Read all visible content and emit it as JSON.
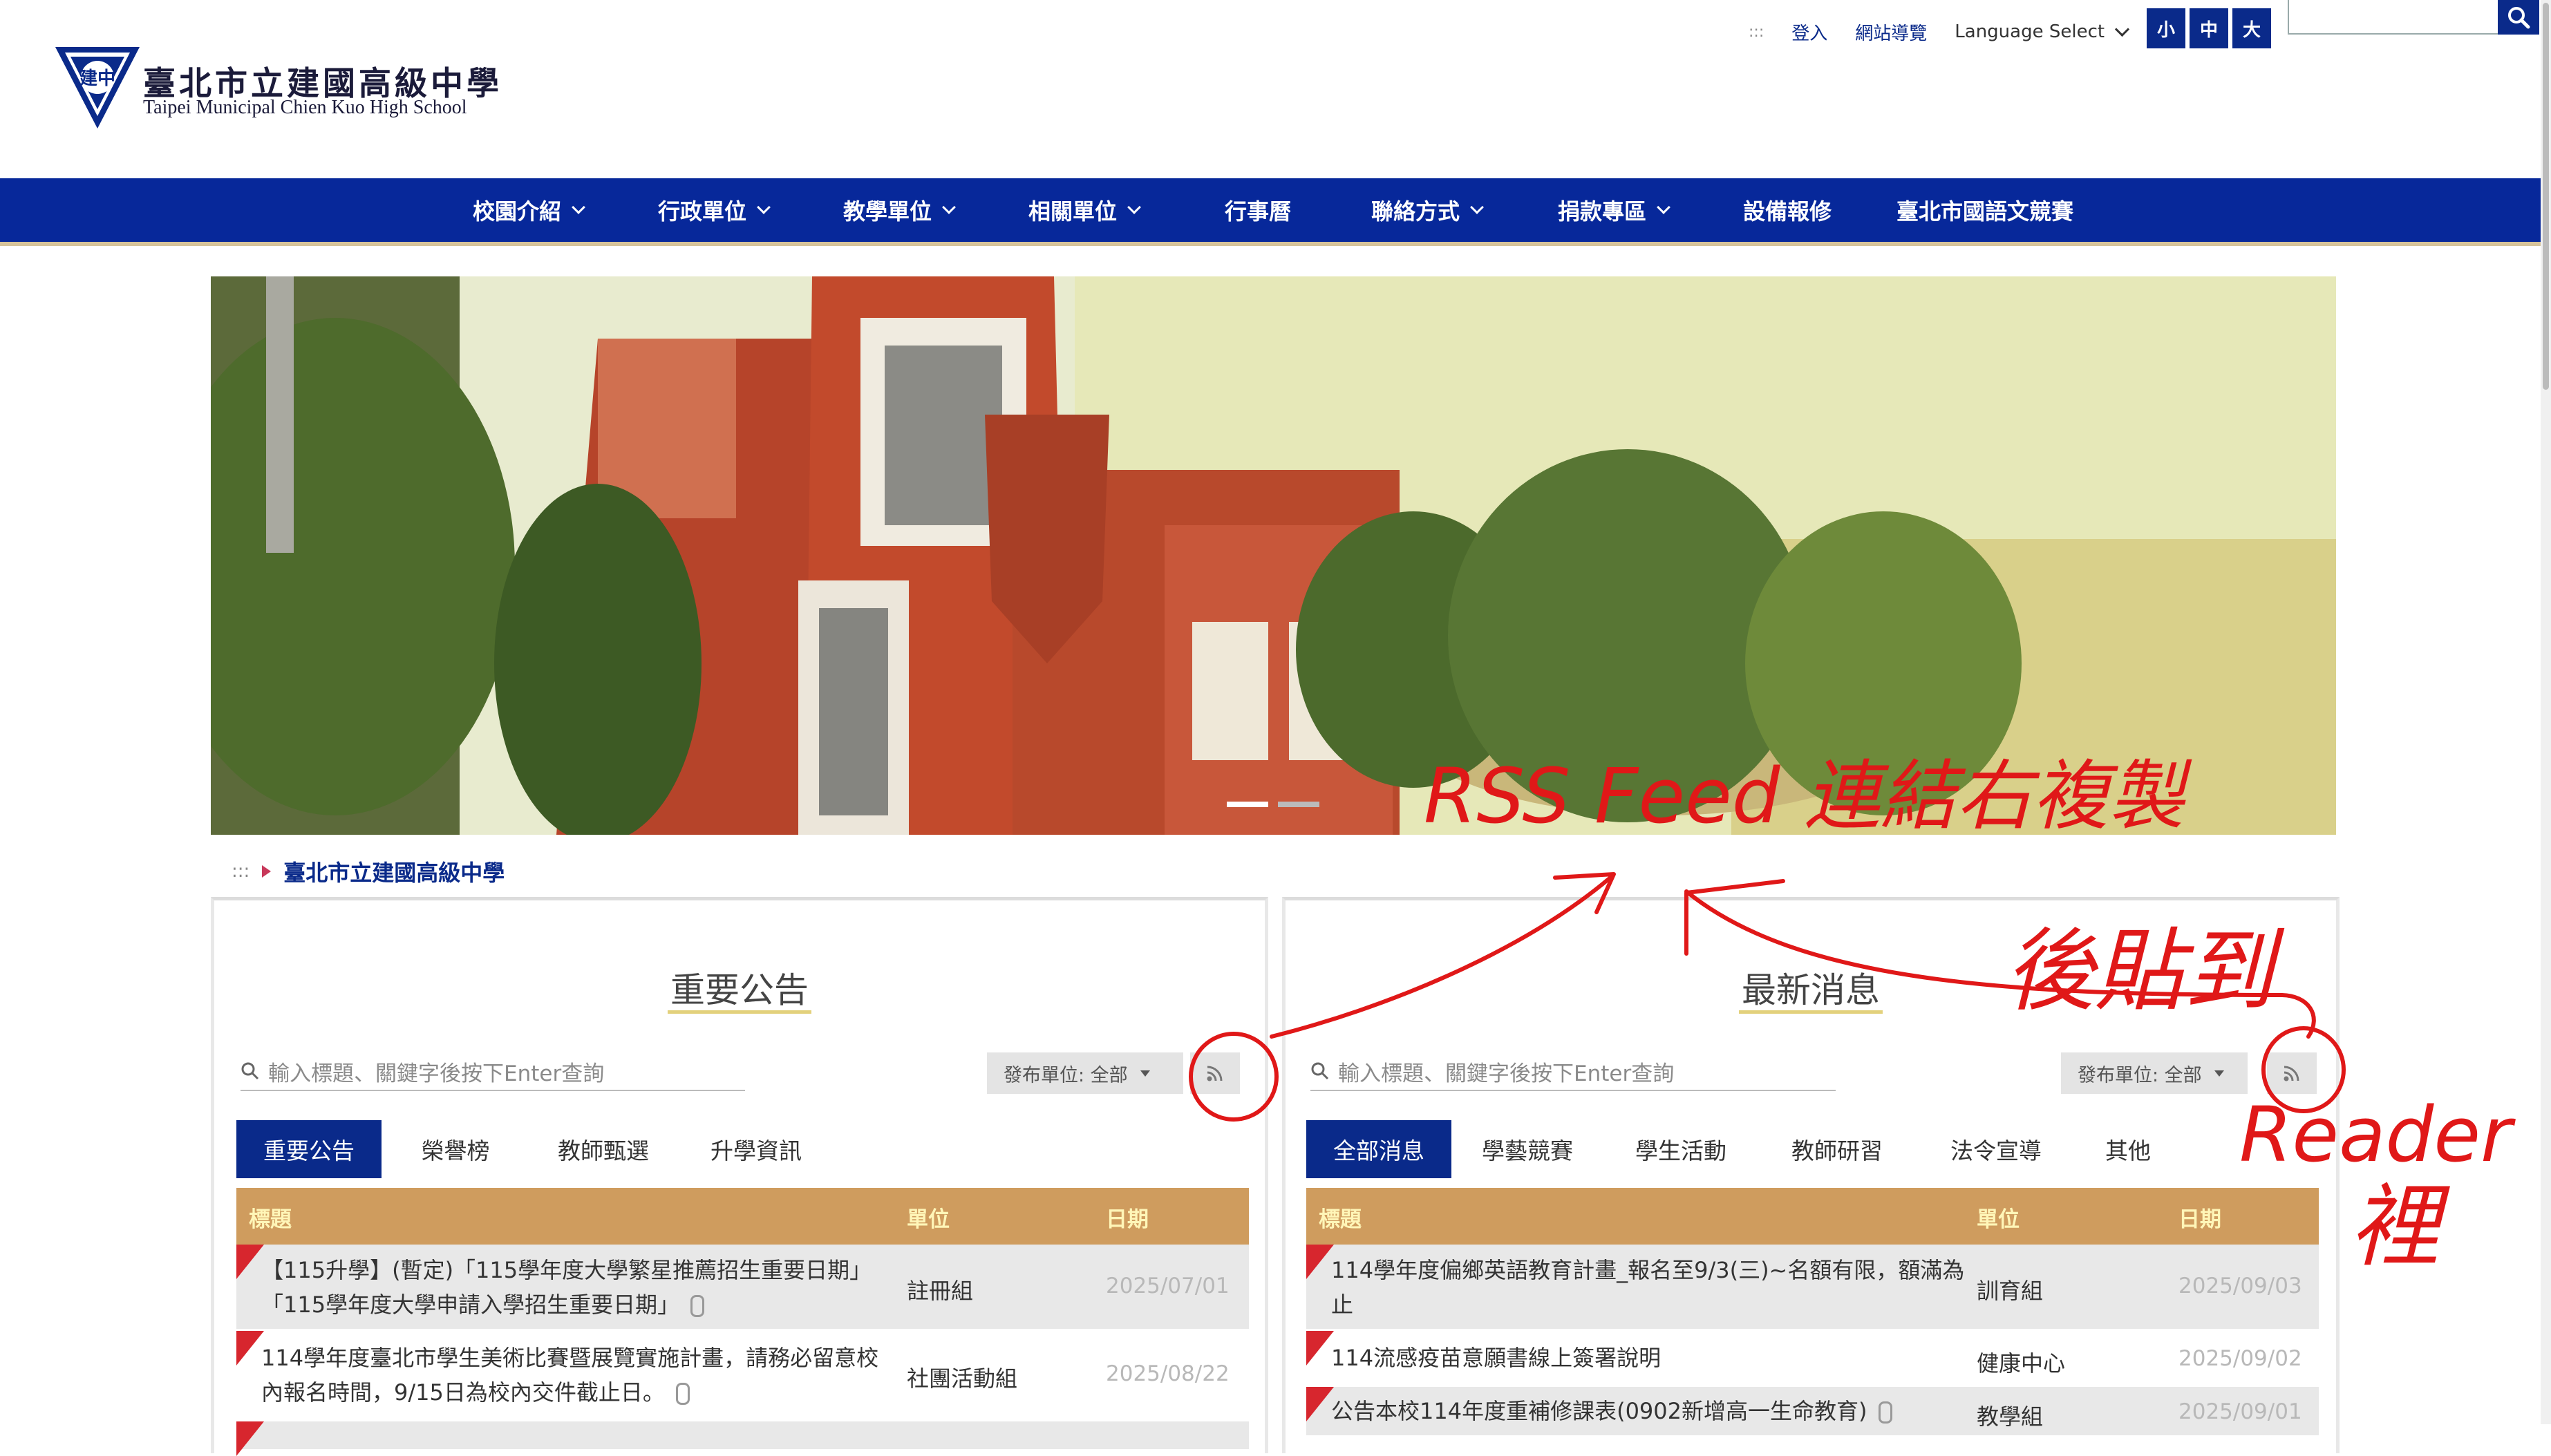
{
  "header": {
    "school_name_zh": "臺北市立建國高級中學",
    "school_name_en": "Taipei Municipal Chien Kuo High School",
    "logo_text": "建中",
    "accesskey": ":::",
    "login": "登入",
    "sitemap": "網站導覽",
    "language_select": "Language Select",
    "font_sizes": [
      "小",
      "中",
      "大"
    ],
    "search_placeholder": ""
  },
  "nav": {
    "items": [
      {
        "label": "校園介紹",
        "dropdown": true
      },
      {
        "label": "行政單位",
        "dropdown": true
      },
      {
        "label": "教學單位",
        "dropdown": true
      },
      {
        "label": "相關單位",
        "dropdown": true
      },
      {
        "label": "行事曆",
        "dropdown": false
      },
      {
        "label": "聯絡方式",
        "dropdown": true
      },
      {
        "label": "捐款專區",
        "dropdown": true
      },
      {
        "label": "設備報修",
        "dropdown": false
      },
      {
        "label": "臺北市國語文競賽",
        "dropdown": false
      }
    ]
  },
  "breadcrumb": {
    "accesskey": ":::",
    "current": "臺北市立建國高級中學"
  },
  "announcements": {
    "title": "重要公告",
    "search_placeholder": "輸入標題、關鍵字後按下Enter查詢",
    "filter_label": "發布單位: 全部",
    "tabs": [
      "重要公告",
      "榮譽榜",
      "教師甄選",
      "升學資訊"
    ],
    "columns": [
      "標題",
      "單位",
      "日期"
    ],
    "rows": [
      {
        "title": "【115升學】(暫定)「115學年度大學繁星推薦招生重要日期」「115學年度大學申請入學招生重要日期」",
        "unit": "註冊組",
        "date": "2025/07/01",
        "attachment": true
      },
      {
        "title": "114學年度臺北市學生美術比賽暨展覽實施計畫，請務必留意校內報名時間，9/15日為校內交件截止日。",
        "unit": "社團活動組",
        "date": "2025/08/22",
        "attachment": true
      }
    ]
  },
  "latest_news": {
    "title": "最新消息",
    "search_placeholder": "輸入標題、關鍵字後按下Enter查詢",
    "filter_label": "發布單位: 全部",
    "tabs": [
      "全部消息",
      "學藝競賽",
      "學生活動",
      "教師研習",
      "法令宣導",
      "其他"
    ],
    "columns": [
      "標題",
      "單位",
      "日期"
    ],
    "rows": [
      {
        "title": "114學年度偏鄉英語教育計畫_報名至9/3(三)~名額有限，額滿為止",
        "unit": "訓育組",
        "date": "2025/09/03"
      },
      {
        "title": "114流感疫苗意願書線上簽署說明",
        "unit": "健康中心",
        "date": "2025/09/02"
      },
      {
        "title": "公告本校114年度重補修課表(0902新增高一生命教育)",
        "unit": "教學組",
        "date": "2025/09/01",
        "attachment": true
      }
    ]
  },
  "annotation": {
    "line1": "RSS Feed 連結右複製",
    "line2": "後貼到",
    "line3": "Reader",
    "line4": "裡"
  },
  "colors": {
    "brand_blue": "#0a2a8a",
    "nav_blue": "#07289a",
    "table_header": "#cf9c5e",
    "flag_red": "#d7262e",
    "annotation_red": "#e01818"
  }
}
